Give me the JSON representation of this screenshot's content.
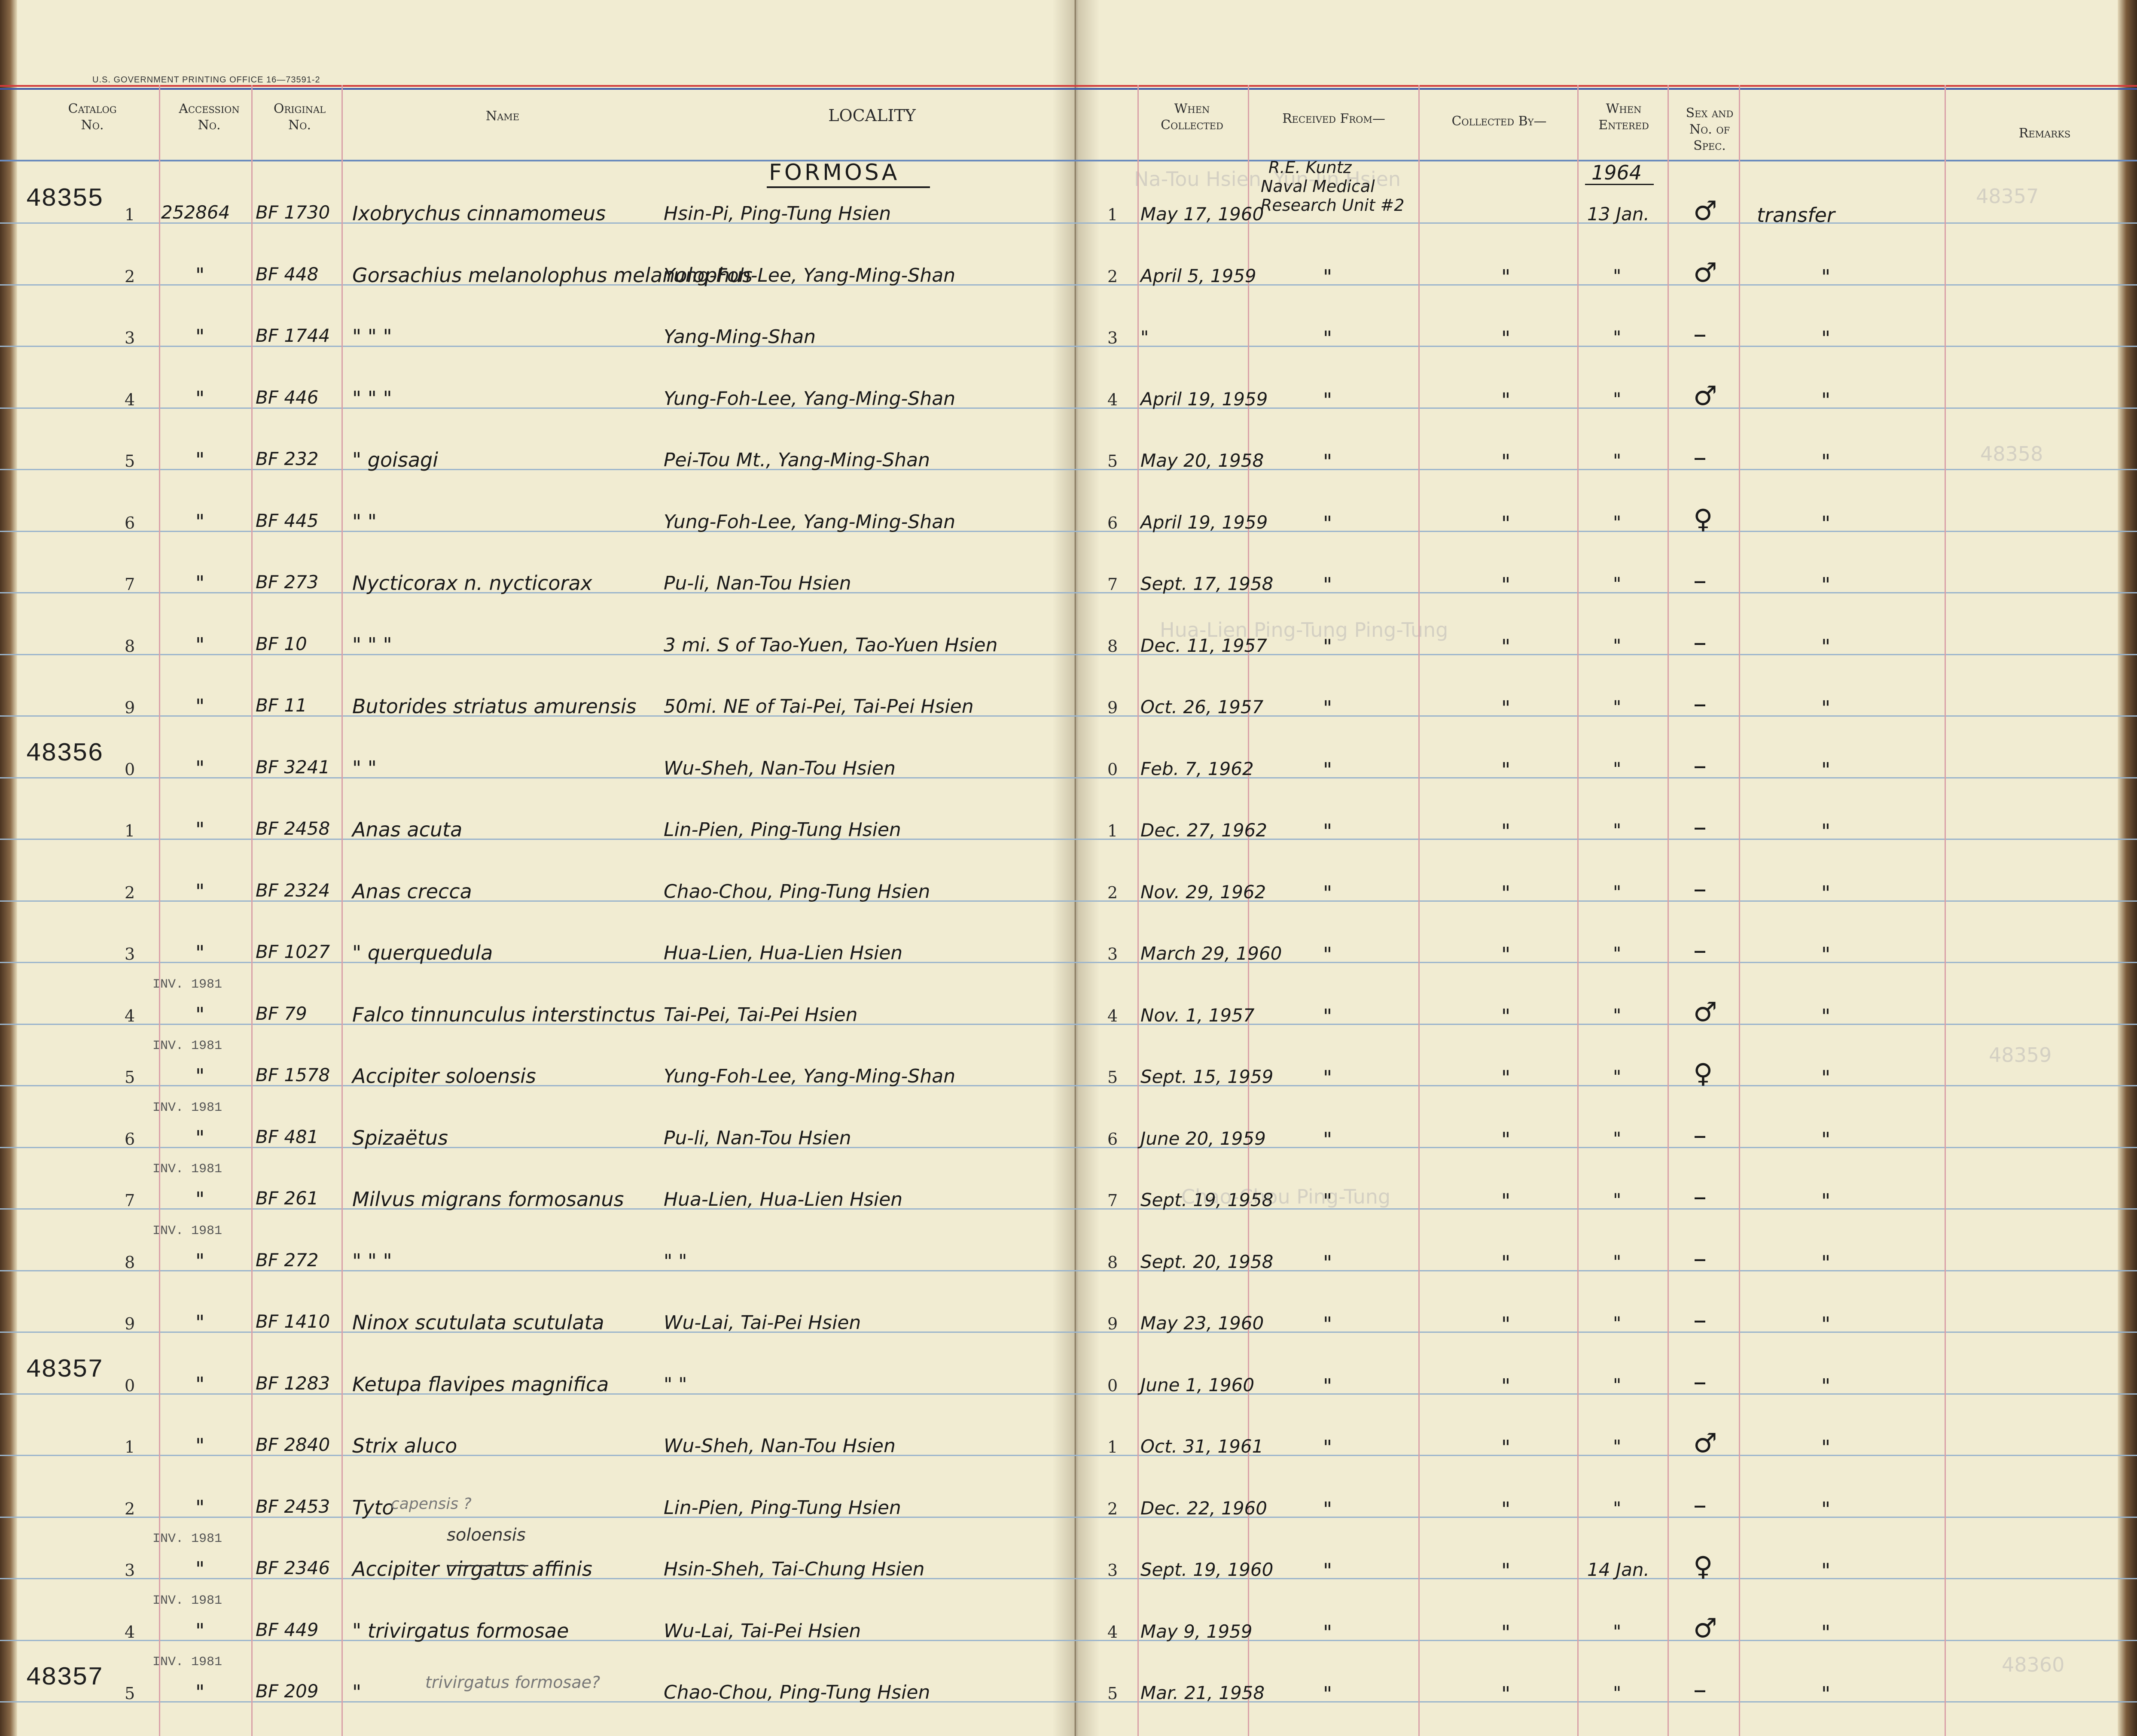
{
  "print_line": "U.S. GOVERNMENT PRINTING OFFICE    16—73591-2",
  "headers": {
    "catalog": [
      "Catalog",
      "No."
    ],
    "accession": [
      "Accession",
      "No."
    ],
    "original": [
      "Original",
      "No."
    ],
    "name": "Name",
    "locality": "LOCALITY",
    "when_collected": [
      "When",
      "Collected"
    ],
    "received_from": "Received From—",
    "collected_by": "Collected By—",
    "when_entered": [
      "When",
      "Entered"
    ],
    "sex": [
      "Sex and",
      "No. of",
      "Spec."
    ],
    "remarks": "Remarks"
  },
  "heading": {
    "region": "FORMOSA",
    "year_entered": "1964",
    "received_from": [
      "R.E. Kuntz",
      "Naval Medical",
      "Research Unit #2"
    ]
  },
  "catalog_numbers": [
    {
      "label": "48355",
      "row": 0
    },
    {
      "label": "48356",
      "row": 9
    },
    {
      "label": "48357",
      "row": 19
    },
    {
      "label": "48357",
      "row": 24
    }
  ],
  "rows": [
    {
      "n": "1",
      "acc": "252864",
      "orig": "BF 1730",
      "name": "Ixobrychus cinnamomeus",
      "loc": "Hsin-Pi, Ping-Tung Hsien",
      "n2": "1",
      "date": "May 17, 1960",
      "recv": "",
      "coll": "",
      "ent": "13 Jan.",
      "sex": "♂",
      "rem": "transfer",
      "inv": ""
    },
    {
      "n": "2",
      "acc": "\"",
      "orig": "BF 448",
      "name": "Gorsachius melanolophus melanolophus",
      "loc": "Yung-Foh-Lee, Yang-Ming-Shan",
      "n2": "2",
      "date": "April 5, 1959",
      "recv": "\"",
      "coll": "\"",
      "ent": "\"",
      "sex": "♂",
      "rem": "\"",
      "inv": ""
    },
    {
      "n": "3",
      "acc": "\"",
      "orig": "BF 1744",
      "name": "\"           \"           \"",
      "loc": "Yang-Ming-Shan",
      "n2": "3",
      "date": "\"",
      "recv": "\"",
      "coll": "\"",
      "ent": "\"",
      "sex": "–",
      "rem": "\"",
      "inv": ""
    },
    {
      "n": "4",
      "acc": "\"",
      "orig": "BF 446",
      "name": "\"           \"           \"",
      "loc": "Yung-Foh-Lee, Yang-Ming-Shan",
      "n2": "4",
      "date": "April 19, 1959",
      "recv": "\"",
      "coll": "\"",
      "ent": "\"",
      "sex": "♂",
      "rem": "\"",
      "inv": ""
    },
    {
      "n": "5",
      "acc": "\"",
      "orig": "BF 232",
      "name": "\"     goisagi",
      "loc": "Pei-Tou Mt., Yang-Ming-Shan",
      "n2": "5",
      "date": "May 20, 1958",
      "recv": "\"",
      "coll": "\"",
      "ent": "\"",
      "sex": "–",
      "rem": "\"",
      "inv": ""
    },
    {
      "n": "6",
      "acc": "\"",
      "orig": "BF 445",
      "name": "\"           \"",
      "loc": "Yung-Foh-Lee, Yang-Ming-Shan",
      "n2": "6",
      "date": "April 19, 1959",
      "recv": "\"",
      "coll": "\"",
      "ent": "\"",
      "sex": "♀",
      "rem": "\"",
      "inv": ""
    },
    {
      "n": "7",
      "acc": "\"",
      "orig": "BF 273",
      "name": "Nycticorax n. nycticorax",
      "loc": "Pu-li, Nan-Tou Hsien",
      "n2": "7",
      "date": "Sept. 17, 1958",
      "recv": "\"",
      "coll": "\"",
      "ent": "\"",
      "sex": "–",
      "rem": "\"",
      "inv": ""
    },
    {
      "n": "8",
      "acc": "\"",
      "orig": "BF 10",
      "name": "\"      \"      \"",
      "loc": "3 mi. S of Tao-Yuen, Tao-Yuen Hsien",
      "n2": "8",
      "date": "Dec. 11, 1957",
      "recv": "\"",
      "coll": "\"",
      "ent": "\"",
      "sex": "–",
      "rem": "\"",
      "inv": ""
    },
    {
      "n": "9",
      "acc": "\"",
      "orig": "BF 11",
      "name": "Butorides striatus amurensis",
      "loc": "50mi. NE of Tai-Pei, Tai-Pei Hsien",
      "n2": "9",
      "date": "Oct. 26, 1957",
      "recv": "\"",
      "coll": "\"",
      "ent": "\"",
      "sex": "–",
      "rem": "\"",
      "inv": ""
    },
    {
      "n": "0",
      "acc": "\"",
      "orig": "BF 3241",
      "name": "\"      \"",
      "loc": "Wu-Sheh, Nan-Tou Hsien",
      "n2": "0",
      "date": "Feb. 7, 1962",
      "recv": "\"",
      "coll": "\"",
      "ent": "\"",
      "sex": "–",
      "rem": "\"",
      "inv": ""
    },
    {
      "n": "1",
      "acc": "\"",
      "orig": "BF 2458",
      "name": "Anas acuta",
      "loc": "Lin-Pien, Ping-Tung Hsien",
      "n2": "1",
      "date": "Dec. 27, 1962",
      "recv": "\"",
      "coll": "\"",
      "ent": "\"",
      "sex": "–",
      "rem": "\"",
      "inv": ""
    },
    {
      "n": "2",
      "acc": "\"",
      "orig": "BF 2324",
      "name": "Anas crecca",
      "loc": "Chao-Chou, Ping-Tung Hsien",
      "n2": "2",
      "date": "Nov. 29, 1962",
      "recv": "\"",
      "coll": "\"",
      "ent": "\"",
      "sex": "–",
      "rem": "\"",
      "inv": ""
    },
    {
      "n": "3",
      "acc": "\"",
      "orig": "BF 1027",
      "name": "\"   querquedula",
      "loc": "Hua-Lien, Hua-Lien Hsien",
      "n2": "3",
      "date": "March 29, 1960",
      "recv": "\"",
      "coll": "\"",
      "ent": "\"",
      "sex": "–",
      "rem": "\"",
      "inv": ""
    },
    {
      "n": "4",
      "acc": "\"",
      "orig": "BF 79",
      "name": "Falco tinnunculus interstinctus",
      "loc": "Tai-Pei,   Tai-Pei Hsien",
      "n2": "4",
      "date": "Nov. 1, 1957",
      "recv": "\"",
      "coll": "\"",
      "ent": "\"",
      "sex": "♂",
      "rem": "\"",
      "inv": "INV. 1981"
    },
    {
      "n": "5",
      "acc": "\"",
      "orig": "BF 1578",
      "name": "Accipiter soloensis",
      "loc": "Yung-Foh-Lee, Yang-Ming-Shan",
      "n2": "5",
      "date": "Sept. 15, 1959",
      "recv": "\"",
      "coll": "\"",
      "ent": "\"",
      "sex": "♀",
      "rem": "\"",
      "inv": "INV. 1981"
    },
    {
      "n": "6",
      "acc": "\"",
      "orig": "BF 481",
      "name": "Spizaëtus",
      "loc": "Pu-li, Nan-Tou Hsien",
      "n2": "6",
      "date": "June 20, 1959",
      "recv": "\"",
      "coll": "\"",
      "ent": "\"",
      "sex": "–",
      "rem": "\"",
      "inv": "INV. 1981"
    },
    {
      "n": "7",
      "acc": "\"",
      "orig": "BF 261",
      "name": "Milvus migrans formosanus",
      "loc": "Hua-Lien, Hua-Lien Hsien",
      "n2": "7",
      "date": "Sept. 19, 1958",
      "recv": "\"",
      "coll": "\"",
      "ent": "\"",
      "sex": "–",
      "rem": "\"",
      "inv": "INV. 1981"
    },
    {
      "n": "8",
      "acc": "\"",
      "orig": "BF 272",
      "name": "\"       \"       \"",
      "loc": "\"          \"",
      "n2": "8",
      "date": "Sept. 20, 1958",
      "recv": "\"",
      "coll": "\"",
      "ent": "\"",
      "sex": "–",
      "rem": "\"",
      "inv": "INV. 1981"
    },
    {
      "n": "9",
      "acc": "\"",
      "orig": "BF 1410",
      "name": "Ninox scutulata scutulata",
      "loc": "Wu-Lai, Tai-Pei Hsien",
      "n2": "9",
      "date": "May 23, 1960",
      "recv": "\"",
      "coll": "\"",
      "ent": "\"",
      "sex": "–",
      "rem": "\"",
      "inv": ""
    },
    {
      "n": "0",
      "acc": "\"",
      "orig": "BF 1283",
      "name": "Ketupa flavipes magnifica",
      "loc": "\"          \"",
      "n2": "0",
      "date": "June 1, 1960",
      "recv": "\"",
      "coll": "\"",
      "ent": "\"",
      "sex": "–",
      "rem": "\"",
      "inv": ""
    },
    {
      "n": "1",
      "acc": "\"",
      "orig": "BF 2840",
      "name": "Strix aluco",
      "loc": "Wu-Sheh, Nan-Tou Hsien",
      "n2": "1",
      "date": "Oct. 31, 1961",
      "recv": "\"",
      "coll": "\"",
      "ent": "\"",
      "sex": "♂",
      "rem": "\"",
      "inv": ""
    },
    {
      "n": "2",
      "acc": "\"",
      "orig": "BF 2453",
      "name": "Tyto",
      "loc": "Lin-Pien, Ping-Tung Hsien",
      "n2": "2",
      "date": "Dec. 22, 1960",
      "recv": "\"",
      "coll": "\"",
      "ent": "\"",
      "sex": "–",
      "rem": "\"",
      "inv": ""
    },
    {
      "n": "3",
      "acc": "\"",
      "orig": "BF 2346",
      "name": "Accipiter virgatus affinis",
      "loc": "Hsin-Sheh, Tai-Chung Hsien",
      "n2": "3",
      "date": "Sept. 19, 1960",
      "recv": "\"",
      "coll": "\"",
      "ent": "14 Jan.",
      "sex": "♀",
      "rem": "\"",
      "inv": "INV. 1981"
    },
    {
      "n": "4",
      "acc": "\"",
      "orig": "BF 449",
      "name": "\"     trivirgatus formosae",
      "loc": "Wu-Lai, Tai-Pei Hsien",
      "n2": "4",
      "date": "May 9, 1959",
      "recv": "\"",
      "coll": "\"",
      "ent": "\"",
      "sex": "♂",
      "rem": "\"",
      "inv": "INV. 1981"
    },
    {
      "n": "5",
      "acc": "\"",
      "orig": "BF 209",
      "name": "\"",
      "loc": "Chao-Chou, Ping-Tung Hsien",
      "n2": "5",
      "date": "Mar. 21, 1958",
      "recv": "\"",
      "coll": "\"",
      "ent": "\"",
      "sex": "–",
      "rem": "\"",
      "inv": "INV. 1981"
    }
  ],
  "annotations": {
    "tyto_note": "capensis ?",
    "affinis_note": "soloensis",
    "row25_note": "trivirgatus formosae?"
  }
}
